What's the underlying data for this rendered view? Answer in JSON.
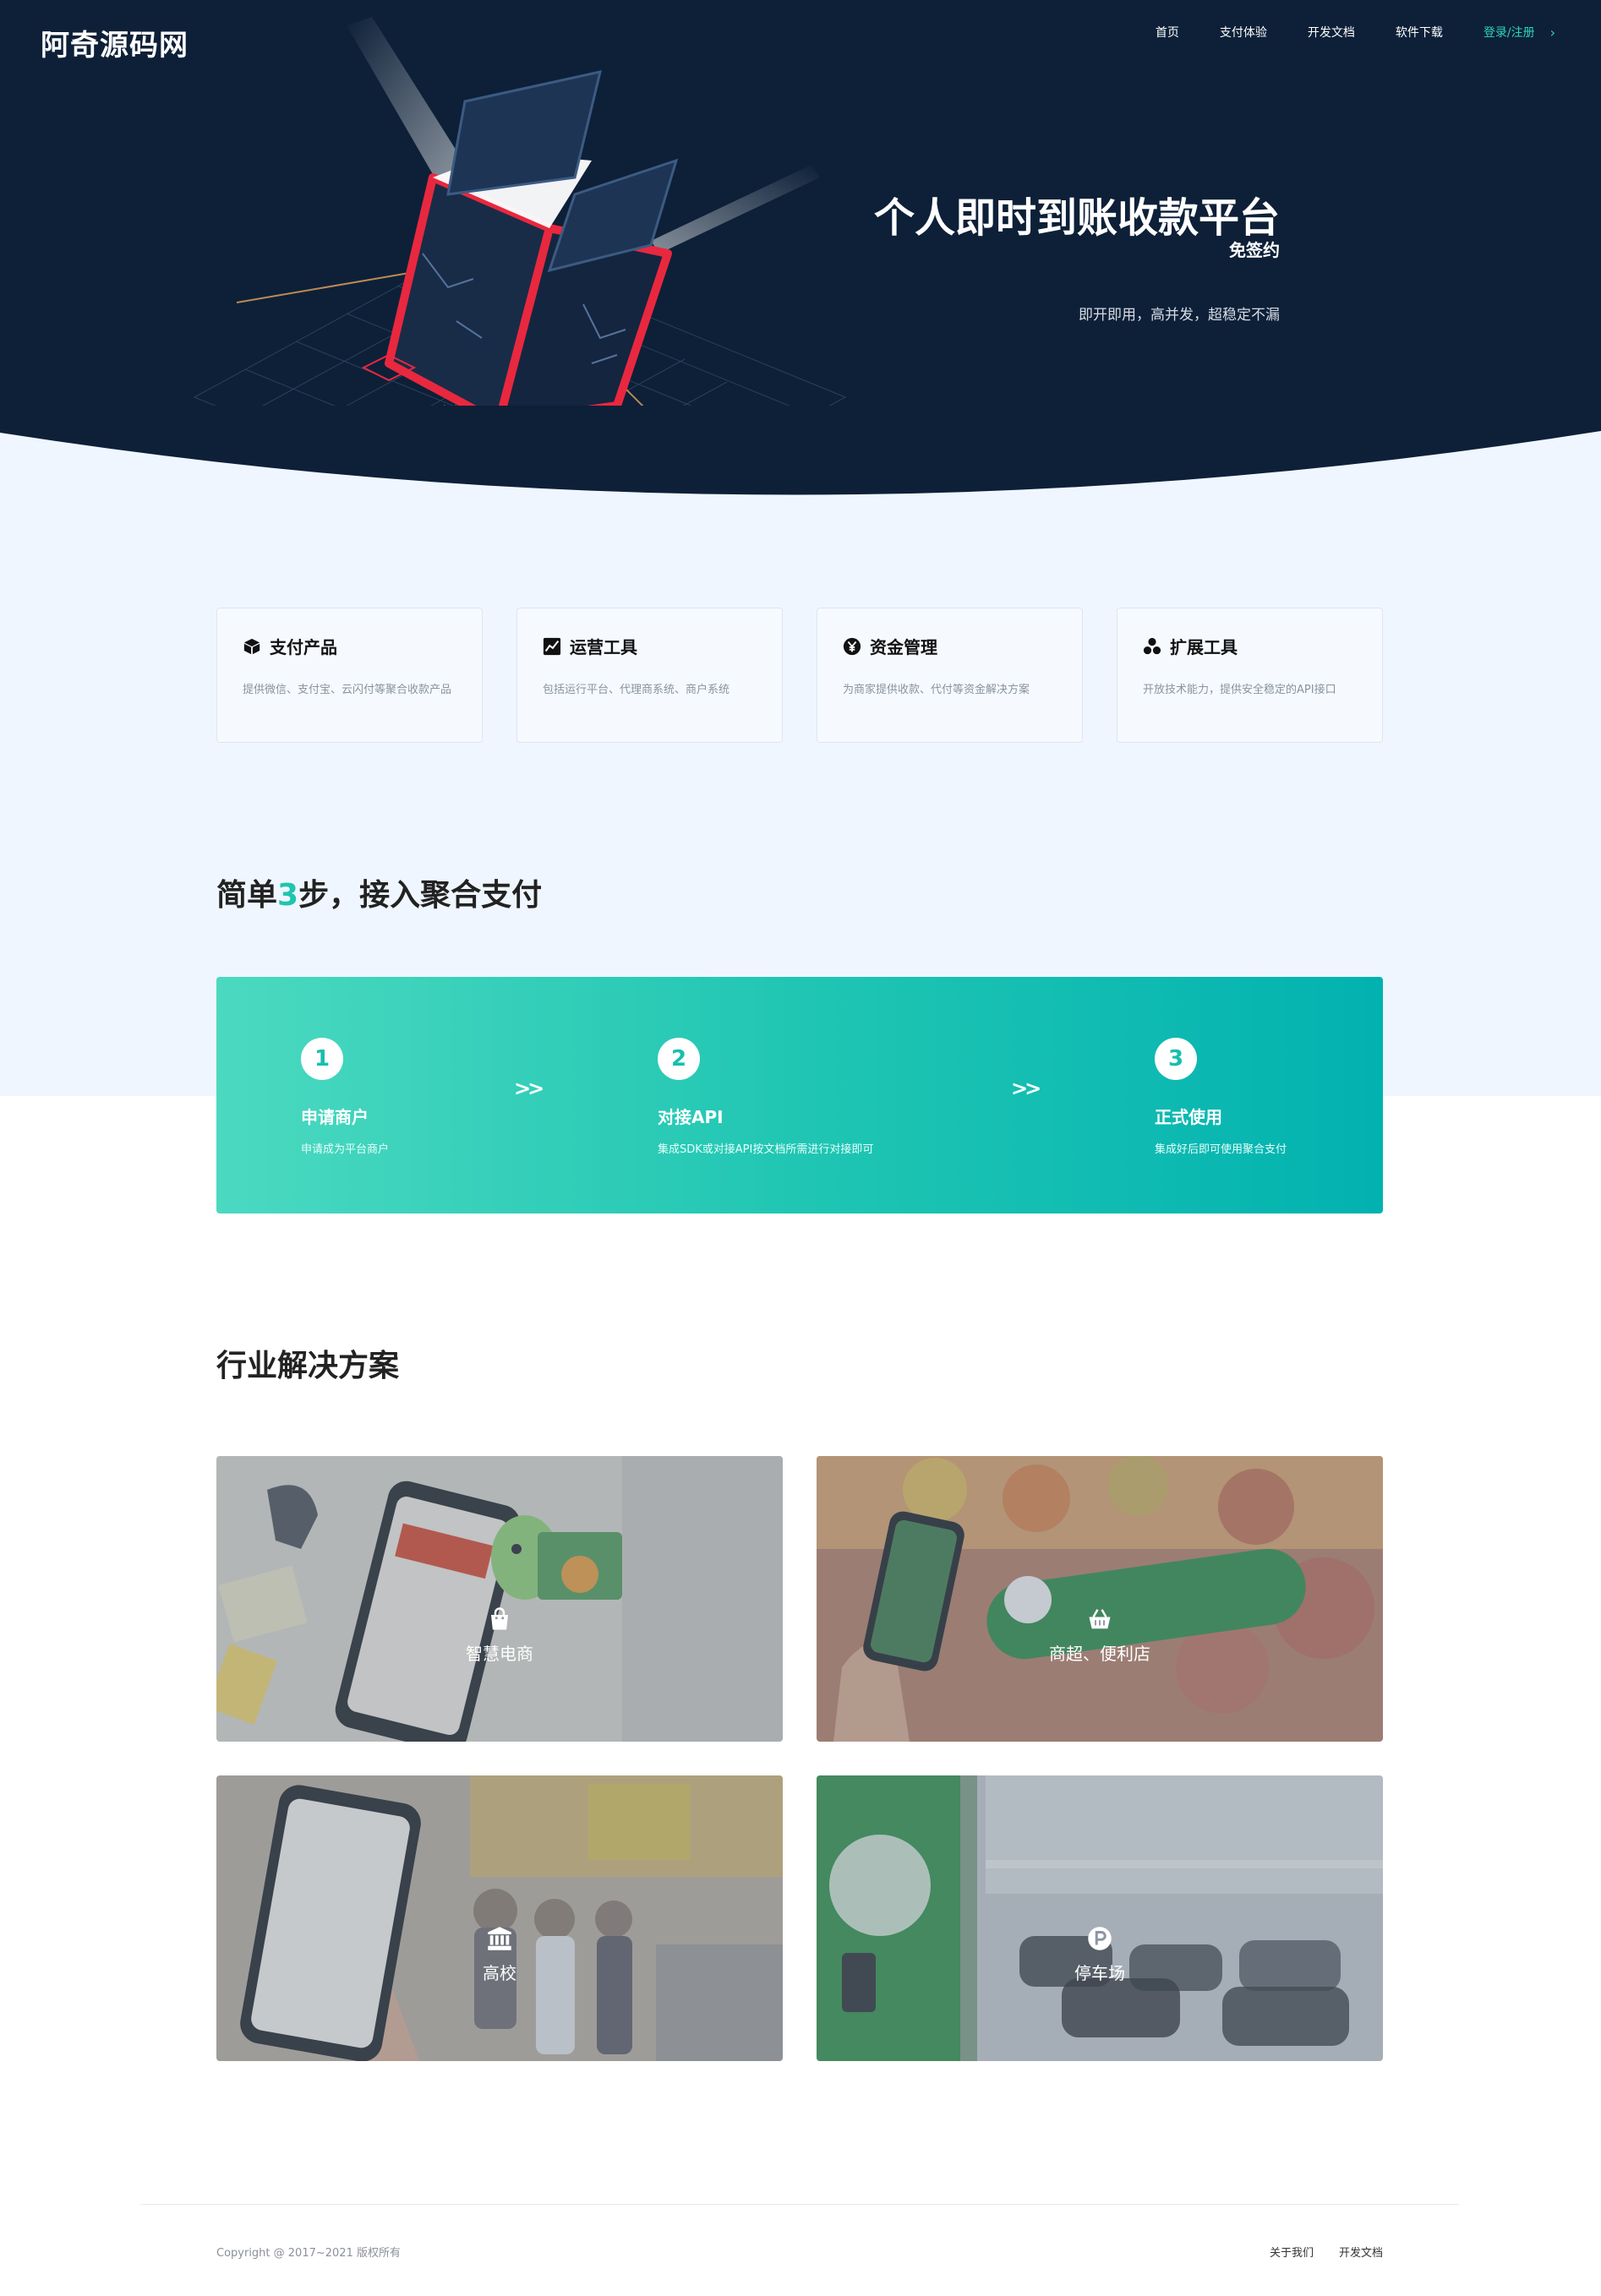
{
  "header": {
    "logo": "阿奇源码网",
    "nav": [
      {
        "label": "首页"
      },
      {
        "label": "支付体验"
      },
      {
        "label": "开发文档"
      },
      {
        "label": "软件下载"
      },
      {
        "label": "登录/注册"
      }
    ]
  },
  "hero": {
    "title": "个人即时到账收款平台",
    "subtitle": "免签约",
    "description": "即开即用，高并发，超稳定不漏",
    "colors": {
      "background": "#0d2038",
      "accent": "#e8283f"
    }
  },
  "features": [
    {
      "icon": "cube-icon",
      "title": "支付产品",
      "desc": "提供微信、支付宝、云闪付等聚合收款产品"
    },
    {
      "icon": "chart-icon",
      "title": "运营工具",
      "desc": "包括运行平台、代理商系统、商户系统"
    },
    {
      "icon": "yen-icon",
      "title": "资金管理",
      "desc": "为商家提供收款、代付等资金解决方案"
    },
    {
      "icon": "cubes-icon",
      "title": "扩展工具",
      "desc": "开放技术能力，提供安全稳定的API接口"
    }
  ],
  "steps_section": {
    "title_pre": "简单",
    "title_num": "3",
    "title_post": "步，接入聚合支付",
    "steps": [
      {
        "num": "1",
        "title": "申请商户",
        "desc": "申请成为平台商户"
      },
      {
        "num": "2",
        "title": "对接API",
        "desc": "集成SDK或对接API按文档所需进行对接即可"
      },
      {
        "num": "3",
        "title": "正式使用",
        "desc": "集成好后即可使用聚合支付"
      }
    ],
    "arrow": ">>"
  },
  "solutions_section": {
    "title": "行业解决方案",
    "items": [
      {
        "icon": "shopping-bag-icon",
        "label": "智慧电商"
      },
      {
        "icon": "basket-icon",
        "label": "商超、便利店"
      },
      {
        "icon": "university-icon",
        "label": "高校"
      },
      {
        "icon": "parking-icon",
        "label": "停车场"
      }
    ]
  },
  "footer": {
    "copyright": "Copyright @ 2017~2021 版权所有",
    "links": [
      {
        "label": "关于我们"
      },
      {
        "label": "开发文档"
      }
    ]
  }
}
